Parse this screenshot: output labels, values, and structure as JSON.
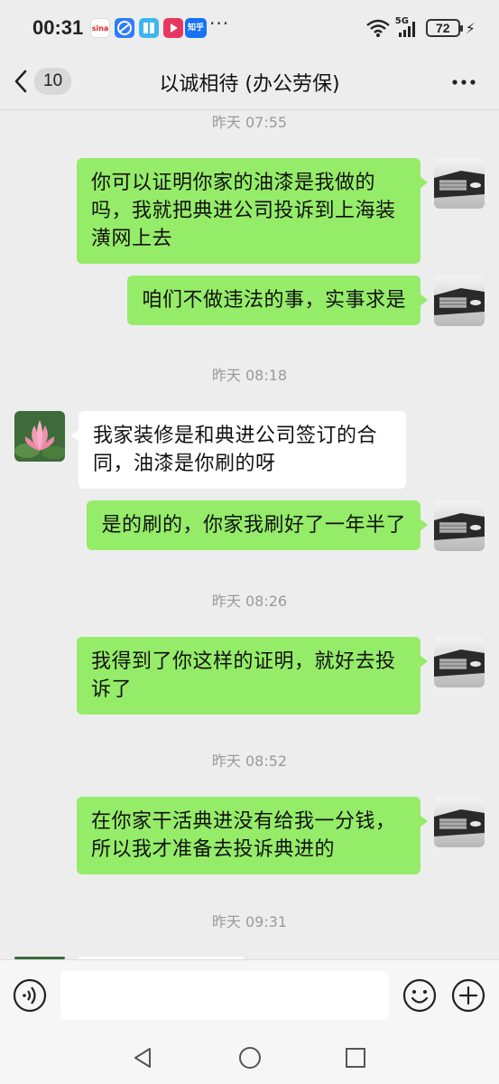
{
  "status_bar": {
    "time": "00:31",
    "more_dots": "···",
    "network": "5G",
    "battery": "72",
    "apps": [
      {
        "name": "sina-app-icon",
        "label": "sina",
        "color": "#ffffff"
      },
      {
        "name": "browser-app-icon",
        "label": "",
        "color": "#2f7cf6"
      },
      {
        "name": "reader-app-icon",
        "label": "",
        "color": "#3cb7f0"
      },
      {
        "name": "video-app-icon",
        "label": "",
        "color": "#e8375e"
      },
      {
        "name": "zhihu-app-icon",
        "label": "知乎",
        "color": "#1772f6"
      }
    ]
  },
  "nav": {
    "unread_count": "10",
    "title": "以诚相待 (办公劳保)"
  },
  "messages": [
    {
      "type": "timestamp",
      "text": "昨天 07:55"
    },
    {
      "type": "self",
      "text": "你可以证明你家的油漆是我做的吗，我就把典进公司投诉到上海装潢网上去"
    },
    {
      "type": "self",
      "text": "咱们不做违法的事，实事求是"
    },
    {
      "type": "timestamp",
      "text": "昨天 08:18"
    },
    {
      "type": "other",
      "text": "我家装修是和典进公司签订的合同，油漆是你刷的呀"
    },
    {
      "type": "self",
      "text": "是的刷的，你家我刷好了一年半了"
    },
    {
      "type": "timestamp",
      "text": "昨天 08:26"
    },
    {
      "type": "self",
      "text": "我得到了你这样的证明，就好去投诉了"
    },
    {
      "type": "timestamp",
      "text": "昨天 08:52"
    },
    {
      "type": "self",
      "text": "在你家干活典进没有给我一分钱，所以我才准备去投诉典进的"
    },
    {
      "type": "timestamp",
      "text": "昨天 09:31"
    }
  ],
  "input": {
    "value": "",
    "placeholder": ""
  },
  "colors": {
    "background": "#ededed",
    "self_bubble": "#95ec69",
    "other_bubble": "#ffffff",
    "timestamp": "#9a9a9a"
  }
}
